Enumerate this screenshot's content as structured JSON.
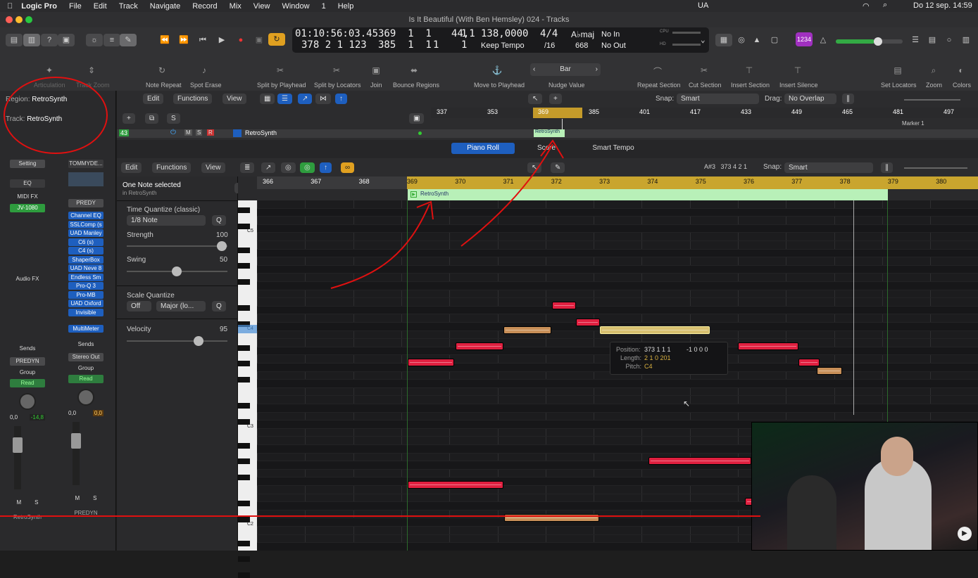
{
  "menubar": {
    "app": "Logic Pro",
    "items": [
      "File",
      "Edit",
      "Track",
      "Navigate",
      "Record",
      "Mix",
      "View",
      "Window",
      "1",
      "Help"
    ],
    "status_lang": "UA",
    "datetime": "Do 12 sep.  14:59"
  },
  "window_title": "Is It Beautiful (With Ben Hemsley) 024 - Tracks",
  "lcd": {
    "smpte": "01:10:56:03.45",
    "bar_pos1": "369  1  1     1",
    "bar_pos2": "378  2  1  123",
    "end_pos": "385  1  1     1",
    "end_pos_b": "1",
    "bpm_tempo": "44,1",
    "tempo": "138,0000",
    "keep_tempo": "Keep Tempo",
    "sig_top": "4/4",
    "sig_bottom": "/16",
    "key": "A♭maj",
    "key_num": "668",
    "in": "No In",
    "out": "No Out",
    "cpu": "CPU",
    "hd": "HD"
  },
  "quicktools": [
    "Articulation",
    "Track Zoom",
    "Note Repeat",
    "Spot Erase",
    "Split by Playhead",
    "Split by Locators",
    "Join",
    "Bounce Regions",
    "Move to Playhead",
    "Nudge Value",
    "Repeat Section",
    "Cut Section",
    "Insert Section",
    "Insert Silence",
    "Set Locators",
    "Zoom",
    "Colors"
  ],
  "nudge_value": "Bar",
  "inspector": {
    "region_label": "Region:",
    "region_name": "RetroSynth",
    "track_label": "Track:",
    "track_name": "RetroSynth",
    "strip1": {
      "setting": "Setting",
      "eq": "EQ",
      "midi_fx": "MIDI FX",
      "instrument": "JV-1080",
      "audio_fx": "Audio FX",
      "sends": "Sends",
      "output": "PREDYN",
      "group": "Group",
      "read": "Read",
      "vol": "0,0",
      "peak": "-14,8",
      "m": "M",
      "s": "S",
      "name": "RetroSynth"
    },
    "strip2": {
      "setting": "TOMMYDE...",
      "predy": "PREDY",
      "plugins": [
        "Channel EQ",
        "SSLComp (s",
        "UAD Manley",
        "C6 (s)",
        "C4 (s)",
        "ShaperBox",
        "UAD Neve 8",
        "Endless Sm",
        "Pro-Q 3",
        "Pro-MB",
        "UAD Oxford",
        "Invisible"
      ],
      "meter": "MultiMeter",
      "sends": "Sends",
      "output": "Stereo Out",
      "group": "Group",
      "read": "Read",
      "vol": "0,0",
      "peak": "0,0",
      "m": "M",
      "s": "S",
      "name": "PREDYN"
    }
  },
  "tracks": {
    "edit": "Edit",
    "functions": "Functions",
    "view": "View",
    "snap_label": "Snap:",
    "snap": "Smart",
    "drag_label": "Drag:",
    "drag": "No Overlap",
    "ruler": [
      "337",
      "353",
      "369",
      "385",
      "401",
      "417",
      "433",
      "449",
      "465",
      "481",
      "497"
    ],
    "track_num": "43",
    "track_m": "M",
    "track_s": "S",
    "track_r": "R",
    "track_name": "RetroSynth",
    "region": "RetroSynth",
    "marker": "Marker 1"
  },
  "tabs": [
    "Piano Roll",
    "Score",
    "Smart Tempo"
  ],
  "pianoroll": {
    "edit": "Edit",
    "functions": "Functions",
    "view": "View",
    "note_info": "A#3   373 4 2 1",
    "snap_label": "Snap:",
    "snap": "Smart",
    "region": "RetroSynth",
    "ruler": [
      "366",
      "367",
      "368",
      "369",
      "370",
      "371",
      "372",
      "373",
      "374",
      "375",
      "376",
      "377",
      "378",
      "379",
      "380"
    ],
    "keys": [
      "C5",
      "C4",
      "C3",
      "C2"
    ]
  },
  "leftpanel": {
    "selection": "One Note selected",
    "in_region": "in RetroSynth",
    "tq_label": "Time Quantize (classic)",
    "tq_value": "1/8 Note",
    "q": "Q",
    "strength_label": "Strength",
    "strength": "100",
    "swing_label": "Swing",
    "swing": "50",
    "sq_label": "Scale Quantize",
    "sq_off": "Off",
    "sq_scale": "Major (lo...",
    "velocity_label": "Velocity",
    "velocity": "95"
  },
  "tooltip": {
    "pos_label": "Position:",
    "pos": "373 1 1 1",
    "pos_delta": "-1 0 0 0",
    "len_label": "Length:",
    "len": "2 1 0 201",
    "pitch_label": "Pitch:",
    "pitch": "C4"
  },
  "colors": {
    "note": "#e02040",
    "selected": "#d8c070",
    "accent": "#1e5fbf",
    "region": "#b8f0b8"
  }
}
